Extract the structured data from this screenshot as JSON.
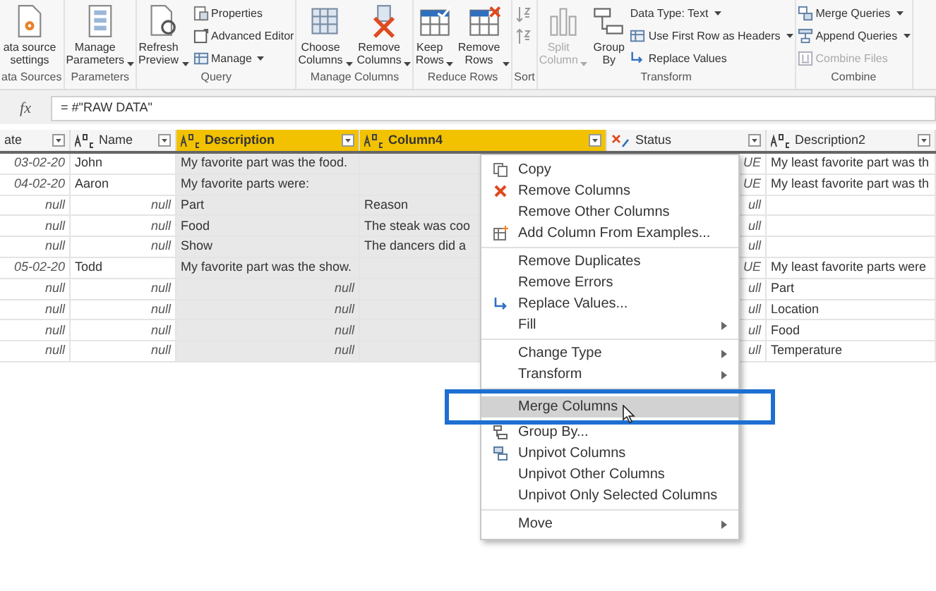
{
  "ribbon": {
    "groups": [
      {
        "label": "ata Sources",
        "kind": "standard",
        "large": [
          {
            "label": "ata source settings",
            "menu": false,
            "disabled": false
          }
        ]
      },
      {
        "label": "Parameters",
        "kind": "standard",
        "large": [
          {
            "label": "Manage Parameters",
            "menu": true,
            "disabled": false
          }
        ]
      },
      {
        "label": "Query",
        "kind": "standard",
        "large": [
          {
            "label": "Refresh Preview",
            "menu": true,
            "disabled": false
          }
        ],
        "small": [
          {
            "label": "Properties",
            "menu": false,
            "disabled": false
          },
          {
            "label": "Advanced Editor",
            "menu": false,
            "disabled": false
          },
          {
            "label": "Manage",
            "menu": true,
            "disabled": false
          }
        ]
      },
      {
        "label": "Manage Columns",
        "kind": "standard",
        "large": [
          {
            "label": "Choose Columns",
            "menu": true,
            "disabled": false
          },
          {
            "label": "Remove Columns",
            "menu": true,
            "disabled": false
          }
        ]
      },
      {
        "label": "Reduce Rows",
        "kind": "standard",
        "large": [
          {
            "label": "Keep Rows",
            "menu": true,
            "disabled": false
          },
          {
            "label": "Remove Rows",
            "menu": true,
            "disabled": false
          }
        ]
      },
      {
        "label": "Sort",
        "kind": "icon_stack"
      },
      {
        "label": "Transform",
        "kind": "standard",
        "large": [
          {
            "label": "Split Column",
            "menu": true,
            "disabled": true
          },
          {
            "label": "Group By",
            "menu": false,
            "disabled": false
          }
        ],
        "small": [
          {
            "label": "Data Type: Text",
            "menu": true,
            "disabled": false
          },
          {
            "label": "Use First Row as Headers",
            "menu": true,
            "disabled": false
          },
          {
            "label": "Replace Values",
            "menu": false,
            "disabled": false
          }
        ]
      },
      {
        "label": "Combine",
        "kind": "standard",
        "small": [
          {
            "label": "Merge Queries",
            "menu": true,
            "disabled": false
          },
          {
            "label": "Append Queries",
            "menu": true,
            "disabled": false
          },
          {
            "label": "Combine Files",
            "menu": false,
            "disabled": true
          }
        ]
      }
    ]
  },
  "formula_bar": {
    "fx": "fx",
    "formula": "= #\"RAW DATA\""
  },
  "table": {
    "columns": [
      {
        "name": "ate",
        "kind": "none",
        "selected": false
      },
      {
        "name": "Name",
        "kind": "text",
        "selected": false
      },
      {
        "name": "Description",
        "kind": "text",
        "selected": true
      },
      {
        "name": "Column4",
        "kind": "text",
        "selected": true
      },
      {
        "name": "Status",
        "kind": "any",
        "selected": false
      },
      {
        "name": "Description2",
        "kind": "text",
        "selected": false
      }
    ],
    "rows": [
      [
        {
          "text": "03-02-20",
          "kind": "value"
        },
        {
          "text": "John",
          "kind": "text"
        },
        {
          "text": "My favorite part was the food.",
          "kind": "text"
        },
        null,
        {
          "text": "UE",
          "kind": "value"
        },
        {
          "text": "My least favorite part was th",
          "kind": "text"
        }
      ],
      [
        {
          "text": "04-02-20",
          "kind": "value"
        },
        {
          "text": "Aaron",
          "kind": "text"
        },
        {
          "text": "My favorite parts were:",
          "kind": "text"
        },
        null,
        {
          "text": "UE",
          "kind": "value"
        },
        {
          "text": "My least favorite part was th",
          "kind": "text"
        }
      ],
      [
        {
          "text": "null",
          "kind": "value"
        },
        {
          "text": "null",
          "kind": "value"
        },
        {
          "text": "Part",
          "kind": "text"
        },
        {
          "text": "Reason",
          "kind": "text"
        },
        {
          "text": "ull",
          "kind": "value"
        },
        null
      ],
      [
        {
          "text": "null",
          "kind": "value"
        },
        {
          "text": "null",
          "kind": "value"
        },
        {
          "text": "Food",
          "kind": "text"
        },
        {
          "text": "The steak was coo",
          "kind": "text"
        },
        {
          "text": "ull",
          "kind": "value"
        },
        null
      ],
      [
        {
          "text": "null",
          "kind": "value"
        },
        {
          "text": "null",
          "kind": "value"
        },
        {
          "text": "Show",
          "kind": "text"
        },
        {
          "text": "The dancers did a",
          "kind": "text"
        },
        {
          "text": "ull",
          "kind": "value"
        },
        null
      ],
      [
        {
          "text": "05-02-20",
          "kind": "value"
        },
        {
          "text": "Todd",
          "kind": "text"
        },
        {
          "text": "My favorite part was the show.",
          "kind": "text"
        },
        null,
        {
          "text": "UE",
          "kind": "value"
        },
        {
          "text": "My least favorite parts were",
          "kind": "text"
        }
      ],
      [
        {
          "text": "null",
          "kind": "value"
        },
        {
          "text": "null",
          "kind": "value"
        },
        {
          "text": "null",
          "kind": "value"
        },
        null,
        {
          "text": "ull",
          "kind": "value"
        },
        {
          "text": "Part",
          "kind": "text"
        }
      ],
      [
        {
          "text": "null",
          "kind": "value"
        },
        {
          "text": "null",
          "kind": "value"
        },
        {
          "text": "null",
          "kind": "value"
        },
        null,
        {
          "text": "ull",
          "kind": "value"
        },
        {
          "text": "Location",
          "kind": "text"
        }
      ],
      [
        {
          "text": "null",
          "kind": "value"
        },
        {
          "text": "null",
          "kind": "value"
        },
        {
          "text": "null",
          "kind": "value"
        },
        null,
        {
          "text": "ull",
          "kind": "value"
        },
        {
          "text": "Food",
          "kind": "text"
        }
      ],
      [
        {
          "text": "null",
          "kind": "value"
        },
        {
          "text": "null",
          "kind": "value"
        },
        {
          "text": "null",
          "kind": "value"
        },
        null,
        {
          "text": "ull",
          "kind": "value"
        },
        {
          "text": "Temperature",
          "kind": "text"
        }
      ]
    ]
  },
  "context_menu": {
    "sections": [
      [
        {
          "label": "Copy",
          "submenu": false,
          "selected": false
        },
        {
          "label": "Remove Columns",
          "submenu": false,
          "selected": false
        },
        {
          "label": "Remove Other Columns",
          "submenu": false,
          "selected": false
        },
        {
          "label": "Add Column From Examples...",
          "submenu": false,
          "selected": false
        }
      ],
      [
        {
          "label": "Remove Duplicates",
          "submenu": false,
          "selected": false
        },
        {
          "label": "Remove Errors",
          "submenu": false,
          "selected": false
        },
        {
          "label": "Replace Values...",
          "submenu": false,
          "selected": false
        },
        {
          "label": "Fill",
          "submenu": true,
          "selected": false
        }
      ],
      [
        {
          "label": "Change Type",
          "submenu": true,
          "selected": false
        },
        {
          "label": "Transform",
          "submenu": true,
          "selected": false
        }
      ],
      [
        {
          "label": "Merge Columns",
          "submenu": false,
          "selected": true
        },
        {
          "label": "Group By...",
          "submenu": false,
          "selected": false
        },
        {
          "label": "Unpivot Columns",
          "submenu": false,
          "selected": false
        },
        {
          "label": "Unpivot Other Columns",
          "submenu": false,
          "selected": false
        },
        {
          "label": "Unpivot Only Selected Columns",
          "submenu": false,
          "selected": false
        }
      ],
      [
        {
          "label": "Move",
          "submenu": true,
          "selected": false
        }
      ]
    ]
  }
}
